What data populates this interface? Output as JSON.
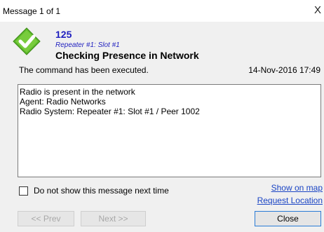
{
  "window": {
    "title": "Message 1 of 1",
    "close_glyph": "X"
  },
  "message": {
    "icon": "success-check-icon",
    "id": "125",
    "source": "Repeater #1: Slot #1",
    "title": "Checking Presence in Network",
    "status": "The command has been executed.",
    "timestamp": "14-Nov-2016 17:49",
    "details": "Radio is present in the network\nAgent: Radio Networks\nRadio System: Repeater #1: Slot #1 / Peer 1002"
  },
  "options": {
    "dont_show_label": "Do not show this message next time",
    "dont_show_checked": false
  },
  "links": {
    "show_on_map": "Show on map",
    "request_location": "Request Location"
  },
  "buttons": {
    "prev": "<< Prev",
    "next": "Next >>",
    "close": "Close"
  },
  "colors": {
    "accent_blue": "#1f1fbf",
    "link_blue": "#1a44c4",
    "check_green": "#5cb82a"
  }
}
